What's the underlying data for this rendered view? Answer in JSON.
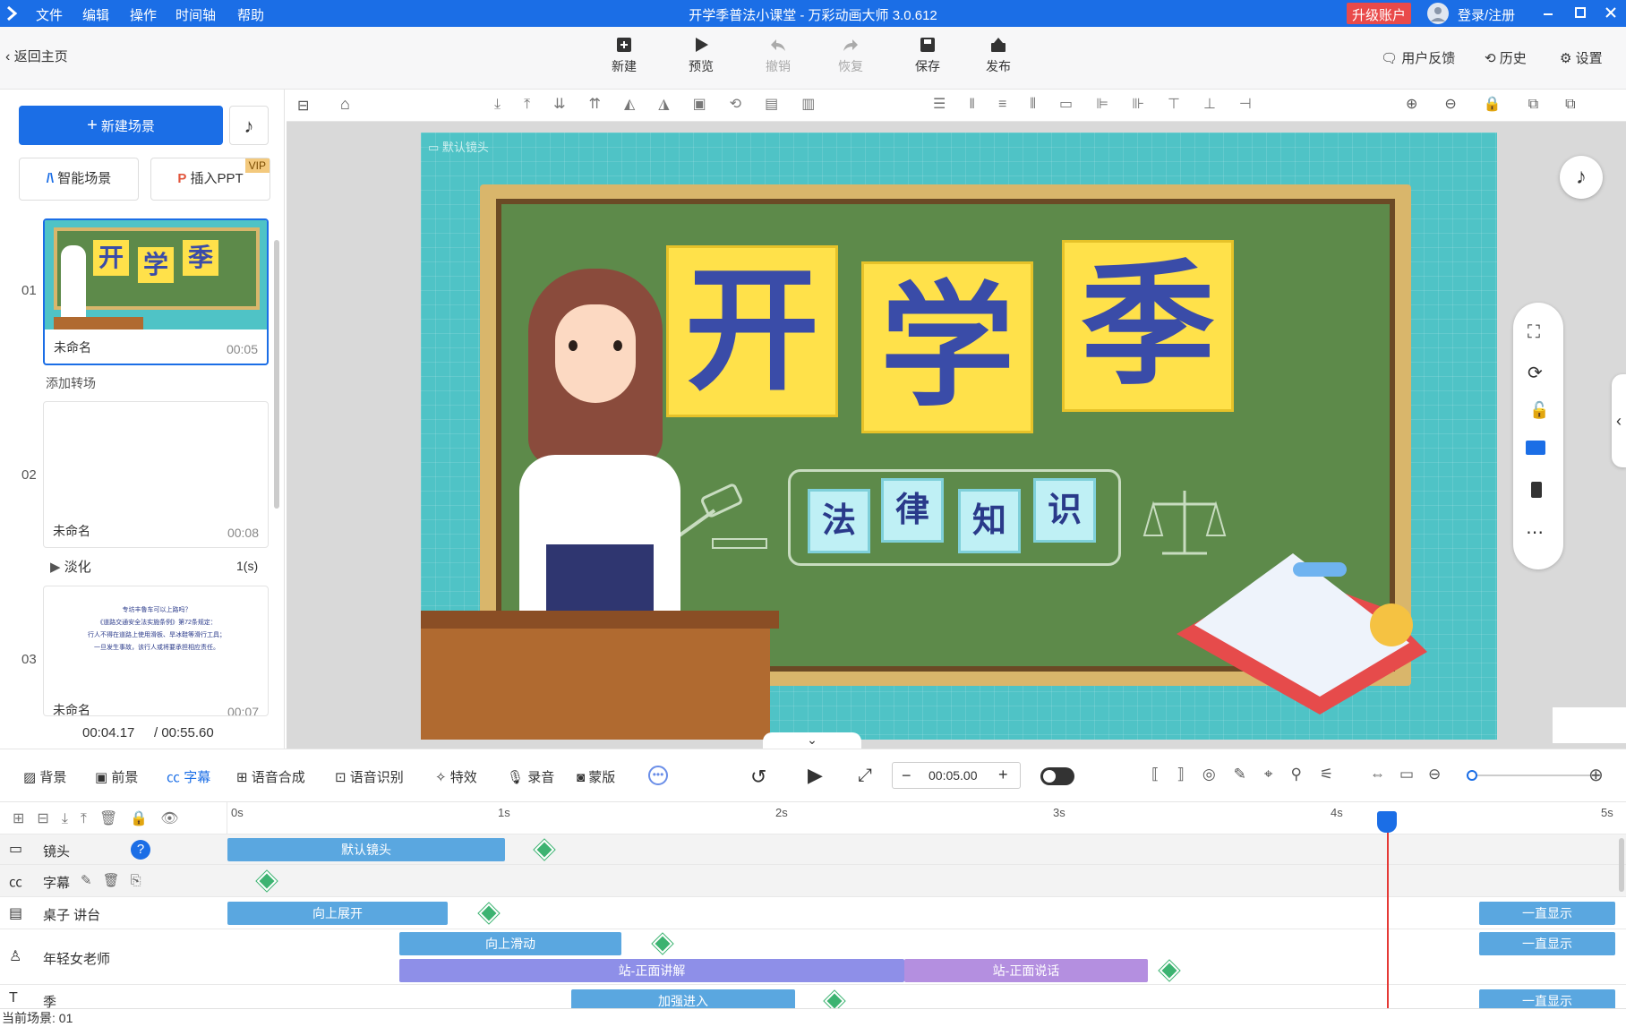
{
  "titlebar": {
    "menus": [
      "文件",
      "编辑",
      "操作",
      "时间轴",
      "帮助"
    ],
    "title": "开学季普法小课堂 - 万彩动画大师 3.0.612",
    "upgrade": "升级账户",
    "login": "登录/注册"
  },
  "toolbar": {
    "back": "返回主页",
    "tools": [
      "新建",
      "预览",
      "撤销",
      "恢复",
      "保存",
      "发布"
    ],
    "feedback": "用户反馈",
    "history": "历史",
    "settings": "设置"
  },
  "left": {
    "new_scene": "新建场景",
    "smart_scene": "智能场景",
    "insert_ppt": "插入PPT",
    "vip": "VIP",
    "add_transition": "添加转场",
    "scenes": [
      {
        "num": "01",
        "name": "未命名",
        "duration": "00:05"
      },
      {
        "num": "02",
        "name": "未命名",
        "duration": "00:08"
      },
      {
        "num": "03",
        "name": "未命名",
        "duration": "00:07"
      }
    ],
    "transition": {
      "name": "淡化",
      "duration": "1(s)"
    },
    "scene3_text": [
      "专坊丰魯车可以上路吗？",
      "《道路交通安全法实施条例》第72条规定：",
      "行人不得在道路上使用滑板、旱冰鞋等滑行工具；",
      "一旦发生事故，该行人或将要承担相应责任。"
    ],
    "current_time": "00:04.17",
    "total_time": "/ 00:55.60"
  },
  "stage": {
    "camera_label": "默认镜头",
    "big_chars": [
      "开",
      "学",
      "季"
    ],
    "small_chars": [
      "法",
      "律",
      "知",
      "识"
    ]
  },
  "bottombar": {
    "tabs": [
      "背景",
      "前景",
      "字幕",
      "语音合成",
      "语音识别",
      "特效",
      "录音",
      "蒙版"
    ],
    "time": "00:05.00"
  },
  "timeline": {
    "ticks": [
      "0s",
      "1s",
      "2s",
      "3s",
      "4s",
      "5s"
    ],
    "rows": [
      {
        "label": "镜头",
        "bars": [
          "默认镜头"
        ]
      },
      {
        "label": "字幕",
        "bars": []
      },
      {
        "label": "桌子 讲台",
        "bars": [
          "向上展开",
          "一直显示"
        ]
      },
      {
        "label": "年轻女老师",
        "bars": [
          "向上滑动",
          "一直显示",
          "站-正面讲解",
          "站-正面说话"
        ]
      },
      {
        "label": "季",
        "bars": [
          "加强进入",
          "一直显示"
        ]
      }
    ],
    "current_scene": "当前场景: 01"
  },
  "colors": {
    "accent": "#1b6ee6",
    "upgrade": "#e94a4a",
    "bar_blue": "#5aa7e0",
    "bar_purple": "#8e8fe8",
    "keyframe": "#3cb371",
    "playhead": "#e53935"
  }
}
